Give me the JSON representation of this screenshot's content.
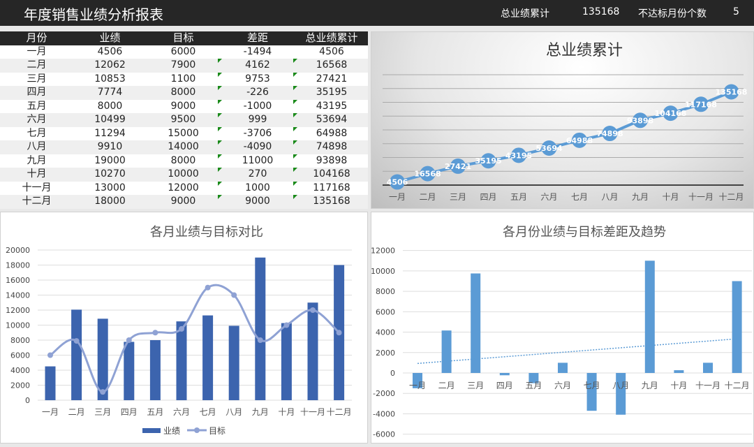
{
  "header": {
    "title": "年度销售业绩分析报表",
    "total_label": "总业绩累计",
    "total_value": "135168",
    "miss_label": "不达标月份个数",
    "miss_value": "5"
  },
  "table": {
    "columns": [
      "月份",
      "业绩",
      "目标",
      "差距",
      "总业绩累计"
    ],
    "rows": [
      [
        "一月",
        "4506",
        "6000",
        "-1494",
        "4506"
      ],
      [
        "二月",
        "12062",
        "7900",
        "4162",
        "16568"
      ],
      [
        "三月",
        "10853",
        "1100",
        "9753",
        "27421"
      ],
      [
        "四月",
        "7774",
        "8000",
        "-226",
        "35195"
      ],
      [
        "五月",
        "8000",
        "9000",
        "-1000",
        "43195"
      ],
      [
        "六月",
        "10499",
        "9500",
        "999",
        "53694"
      ],
      [
        "七月",
        "11294",
        "15000",
        "-3706",
        "64988"
      ],
      [
        "八月",
        "9910",
        "14000",
        "-4090",
        "74898"
      ],
      [
        "九月",
        "19000",
        "8000",
        "11000",
        "93898"
      ],
      [
        "十月",
        "10270",
        "10000",
        "270",
        "104168"
      ],
      [
        "十一月",
        "13000",
        "12000",
        "1000",
        "117168"
      ],
      [
        "十二月",
        "18000",
        "9000",
        "9000",
        "135168"
      ]
    ]
  },
  "colors": {
    "bar": "#3c64ae",
    "line": "#8fa2d4",
    "cum": "#5b9bd5",
    "diff": "#5b9bd5",
    "header": "#262626",
    "flag": "#1a8a1a"
  },
  "chart_data": [
    {
      "type": "line",
      "title": "总业绩累计",
      "categories": [
        "一月",
        "二月",
        "三月",
        "四月",
        "五月",
        "六月",
        "七月",
        "八月",
        "九月",
        "十月",
        "十一月",
        "十二月"
      ],
      "values": [
        4506,
        16568,
        27421,
        35195,
        43195,
        53694,
        64988,
        74898,
        93898,
        104168,
        117168,
        135168
      ],
      "labels": [
        "4506",
        "16568",
        "27421",
        "35195",
        "43195",
        "53694",
        "64988",
        "74898",
        "93898",
        "104168",
        "117168",
        "135168"
      ],
      "ylim": [
        0,
        160000
      ],
      "grid": true
    },
    {
      "type": "bar",
      "title": "各月业绩与目标对比",
      "categories": [
        "一月",
        "二月",
        "三月",
        "四月",
        "五月",
        "六月",
        "七月",
        "八月",
        "九月",
        "十月",
        "十一月",
        "十二月"
      ],
      "series": [
        {
          "name": "业绩",
          "type": "bar",
          "values": [
            4506,
            12062,
            10853,
            7774,
            8000,
            10499,
            11294,
            9910,
            19000,
            10270,
            13000,
            18000
          ]
        },
        {
          "name": "目标",
          "type": "line",
          "values": [
            6000,
            7900,
            1100,
            8000,
            9000,
            9500,
            15000,
            14000,
            8000,
            10000,
            12000,
            9000
          ]
        }
      ],
      "yticks": [
        "0",
        "2000",
        "4000",
        "6000",
        "8000",
        "10000",
        "12000",
        "14000",
        "16000",
        "18000",
        "20000"
      ],
      "ylim": [
        0,
        20000
      ],
      "grid": true,
      "legend": "bottom"
    },
    {
      "type": "bar",
      "title": "各月份业绩与目标差距及趋势",
      "categories": [
        "一月",
        "二月",
        "三月",
        "四月",
        "五月",
        "六月",
        "七月",
        "八月",
        "九月",
        "十月",
        "十一月",
        "十二月"
      ],
      "values": [
        -1494,
        4162,
        9753,
        -226,
        -1000,
        999,
        -3706,
        -4090,
        11000,
        270,
        1000,
        9000
      ],
      "yticks": [
        "-6000",
        "-4000",
        "-2000",
        "0",
        "2000",
        "4000",
        "6000",
        "8000",
        "10000",
        "12000"
      ],
      "ylim": [
        -6000,
        12000
      ],
      "trendline": "linear",
      "grid": true
    }
  ]
}
